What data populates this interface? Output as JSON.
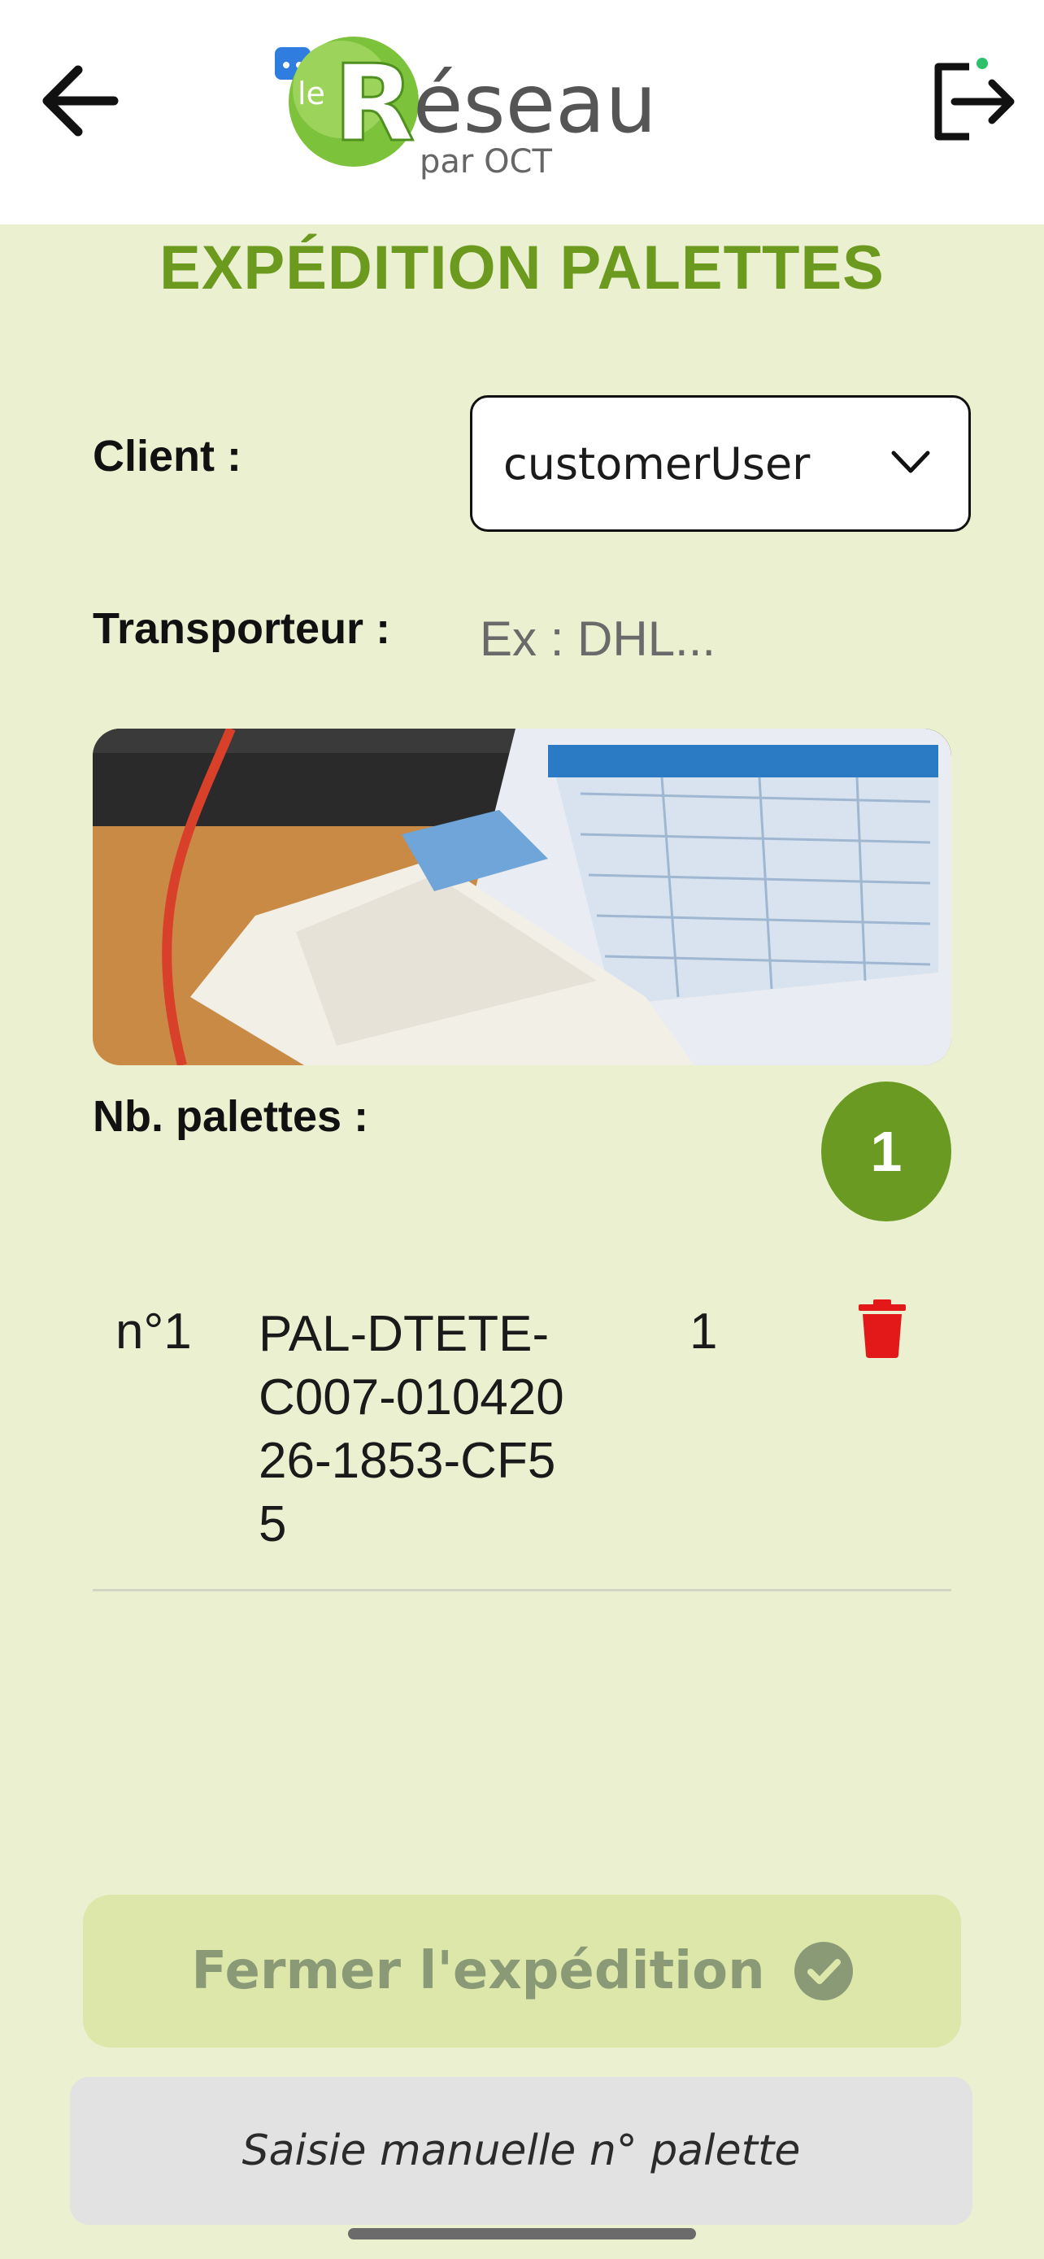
{
  "header": {
    "logo_text": "Réseau",
    "logo_prefix": "le",
    "logo_sub": "par OCT",
    "back_icon": "arrow-left-icon",
    "logout_icon": "logout-icon"
  },
  "page": {
    "title": "EXPÉDITION PALETTES"
  },
  "form": {
    "client_label": "Client :",
    "client_value": "customerUser",
    "carrier_label": "Transporteur :",
    "carrier_placeholder": "Ex : DHL..."
  },
  "pallets": {
    "count_label": "Nb. palettes :",
    "count": "1",
    "items": [
      {
        "num": "n°1",
        "code": "PAL-DTETE-C007-01042026-1853-CF55",
        "qty": "1"
      }
    ]
  },
  "actions": {
    "close_label": "Fermer l'expédition",
    "manual_label": "Saisie manuelle n° palette"
  },
  "colors": {
    "background": "#eaf0d0",
    "accent": "#6c9a1f",
    "badge": "#6a9a22",
    "delete": "#e31818",
    "close_button": "#dde7aa"
  }
}
